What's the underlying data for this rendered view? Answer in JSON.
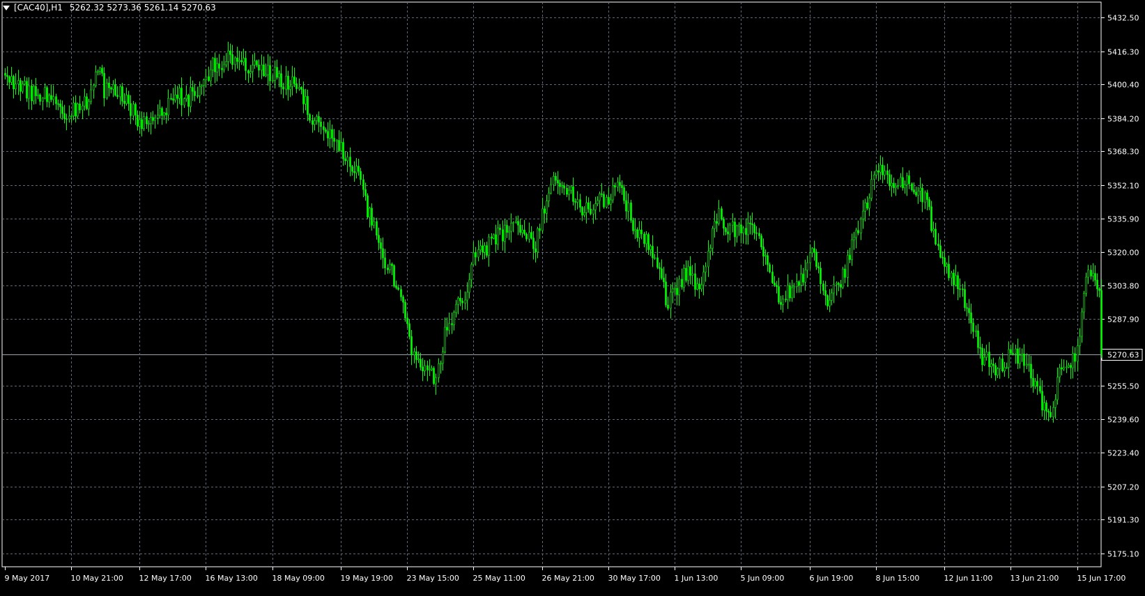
{
  "header": {
    "symbol": "[CAC40],H1",
    "ohlc": "5262.32 5273.36 5261.14 5270.63"
  },
  "colors": {
    "background": "#000000",
    "candle": "#00ff00",
    "grid": "#5f6b7a",
    "axis": "#ffffff",
    "last_price_line": "#9aa4b0"
  },
  "chart_data": {
    "type": "candlestick",
    "symbol": "CAC40",
    "timeframe": "H1",
    "last_price": 5270.63,
    "ylim": [
      5168.6,
      5440.0
    ],
    "grid": true,
    "y_ticks": [
      5432.5,
      5416.3,
      5400.4,
      5384.2,
      5368.3,
      5352.1,
      5335.9,
      5320.0,
      5303.8,
      5287.9,
      5270.63,
      5255.5,
      5239.6,
      5223.4,
      5207.2,
      5191.3,
      5175.1
    ],
    "y_tick_labels": [
      "5432.50",
      "5416.30",
      "5400.40",
      "5384.20",
      "5368.30",
      "5352.10",
      "5335.90",
      "5320.00",
      "5303.80",
      "5287.90",
      "5270.63",
      "5255.50",
      "5239.60",
      "5223.40",
      "5207.20",
      "5191.30",
      "5175.10"
    ],
    "x_tick_labels": [
      "9 May 2017",
      "10 May 21:00",
      "12 May 17:00",
      "16 May 13:00",
      "18 May 09:00",
      "19 May 19:00",
      "23 May 15:00",
      "25 May 11:00",
      "26 May 21:00",
      "30 May 17:00",
      "1 Jun 13:00",
      "5 Jun 09:00",
      "6 Jun 19:00",
      "8 Jun 15:00",
      "12 Jun 11:00",
      "13 Jun 21:00",
      "15 Jun 17:00"
    ],
    "path_index": [
      0,
      9,
      18,
      27,
      36,
      40,
      43,
      45,
      55,
      60,
      70,
      78,
      82,
      84,
      95,
      102,
      110,
      120,
      130,
      133,
      140,
      148,
      160,
      170,
      178,
      185,
      195,
      200,
      208,
      212,
      220,
      228,
      232,
      240,
      248,
      255,
      262,
      270,
      278,
      285,
      292,
      300,
      308,
      315,
      320,
      324,
      326,
      334,
      340,
      350,
      358,
      365,
      372,
      380,
      385,
      390,
      396,
      402,
      408,
      416,
      423,
      428,
      435,
      442,
      448,
      455,
      462,
      468,
      472,
      478,
      484,
      490,
      496
    ],
    "path_close": [
      5406,
      5398,
      5395,
      5385,
      5390,
      5402,
      5405,
      5398,
      5394,
      5382,
      5386,
      5397,
      5392,
      5395,
      5410,
      5414,
      5408,
      5406,
      5400,
      5398,
      5383,
      5376,
      5355,
      5320,
      5303,
      5270,
      5258,
      5285,
      5300,
      5316,
      5324,
      5332,
      5330,
      5322,
      5360,
      5350,
      5340,
      5345,
      5350,
      5331,
      5322,
      5295,
      5310,
      5300,
      5330,
      5339,
      5330,
      5330,
      5330,
      5298,
      5302,
      5320,
      5295,
      5310,
      5330,
      5345,
      5362,
      5351,
      5355,
      5346,
      5318,
      5309,
      5295,
      5270,
      5262,
      5270,
      5268,
      5250,
      5240,
      5266,
      5267,
      5311,
      5301
    ],
    "bar_count": 497,
    "x_tick_bar_index": [
      0,
      30,
      61,
      91,
      121,
      152,
      182,
      212,
      243,
      273,
      303,
      333,
      364,
      394,
      425,
      455,
      485
    ]
  }
}
